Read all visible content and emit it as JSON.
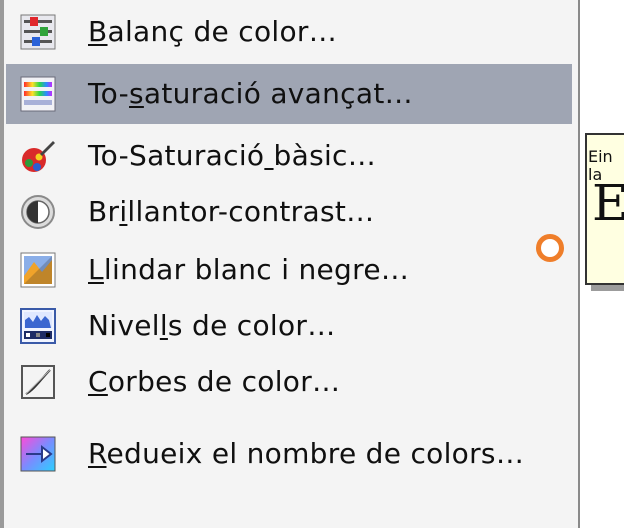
{
  "menu": {
    "items": [
      {
        "label": "Balanç de color…",
        "mnemonic_index": 0,
        "icon": "color-balance-icon"
      },
      {
        "label": "To-saturació avançat…",
        "mnemonic_index": 3,
        "icon": "hue-saturation-advanced-icon",
        "highlighted": true
      },
      {
        "label": "To-Saturació bàsic…",
        "mnemonic_index": 12,
        "icon": "hue-saturation-basic-icon"
      },
      {
        "label": "Brillantor-contrast…",
        "mnemonic_index": 2,
        "icon": "brightness-contrast-icon"
      },
      {
        "label": "Llindar blanc i negre…",
        "mnemonic_index": 0,
        "icon": "threshold-icon"
      },
      {
        "label": "Nivells de color…",
        "mnemonic_index": 5,
        "icon": "levels-icon"
      },
      {
        "label": "Corbes de color…",
        "mnemonic_index": 0,
        "icon": "curves-icon"
      },
      {
        "label": "Redueix el nombre de colors…",
        "mnemonic_index": 0,
        "icon": "reduce-colors-icon"
      }
    ]
  },
  "tooltip": {
    "small_text": "Ein",
    "small_text_line2": "la",
    "big_text": "E"
  },
  "colors": {
    "menu_bg": "#f4f4f4",
    "highlight_bg": "#9fa5b3",
    "tooltip_bg": "#ffffe1",
    "bullet": "#ef7e2a"
  }
}
